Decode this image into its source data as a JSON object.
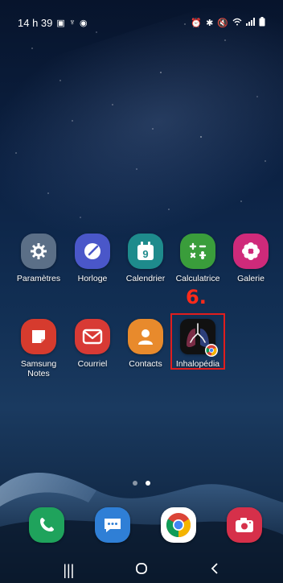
{
  "status_bar": {
    "time": "14 h 39",
    "left_icons": [
      "image-notification-icon",
      "usb-icon",
      "account-icon"
    ],
    "right_icons": [
      "alarm-icon",
      "bluetooth-icon",
      "mute-icon",
      "wifi-icon",
      "signal-icon",
      "battery-icon"
    ]
  },
  "apps_row1": [
    {
      "label": "Paramètres",
      "icon": "gear-icon",
      "color": "#5b6f87"
    },
    {
      "label": "Horloge",
      "icon": "clock-icon",
      "color": "#4a57c9"
    },
    {
      "label": "Calendrier",
      "icon": "calendar-icon",
      "color": "#1e8b8c",
      "badge": "9"
    },
    {
      "label": "Calculatrice",
      "icon": "calculator-icon",
      "color": "#3a9d3b"
    },
    {
      "label": "Galerie",
      "icon": "flower-icon",
      "color": "#cf2a7a"
    }
  ],
  "apps_row2": [
    {
      "label": "Samsung Notes",
      "icon": "notes-icon",
      "color": "#d63b2e"
    },
    {
      "label": "Courriel",
      "icon": "mail-icon",
      "color": "#d83a35"
    },
    {
      "label": "Contacts",
      "icon": "person-icon",
      "color": "#e88a2c"
    },
    {
      "label": "Inhalopédia",
      "icon": "lungs-icon",
      "color": "#111111"
    }
  ],
  "annotation": {
    "text": "6.",
    "color": "#ff2a1a"
  },
  "dock": [
    {
      "name": "phone-icon",
      "color": "#1fa35c"
    },
    {
      "name": "messages-icon",
      "color": "#2f7fd6"
    },
    {
      "name": "chrome-icon",
      "color": "#ffffff"
    },
    {
      "name": "camera-icon",
      "color": "#d6304a"
    }
  ],
  "page_indicator": {
    "pages": 2,
    "active": 2
  },
  "navbar": {
    "recent": "|||",
    "home": "O",
    "back": "<"
  }
}
